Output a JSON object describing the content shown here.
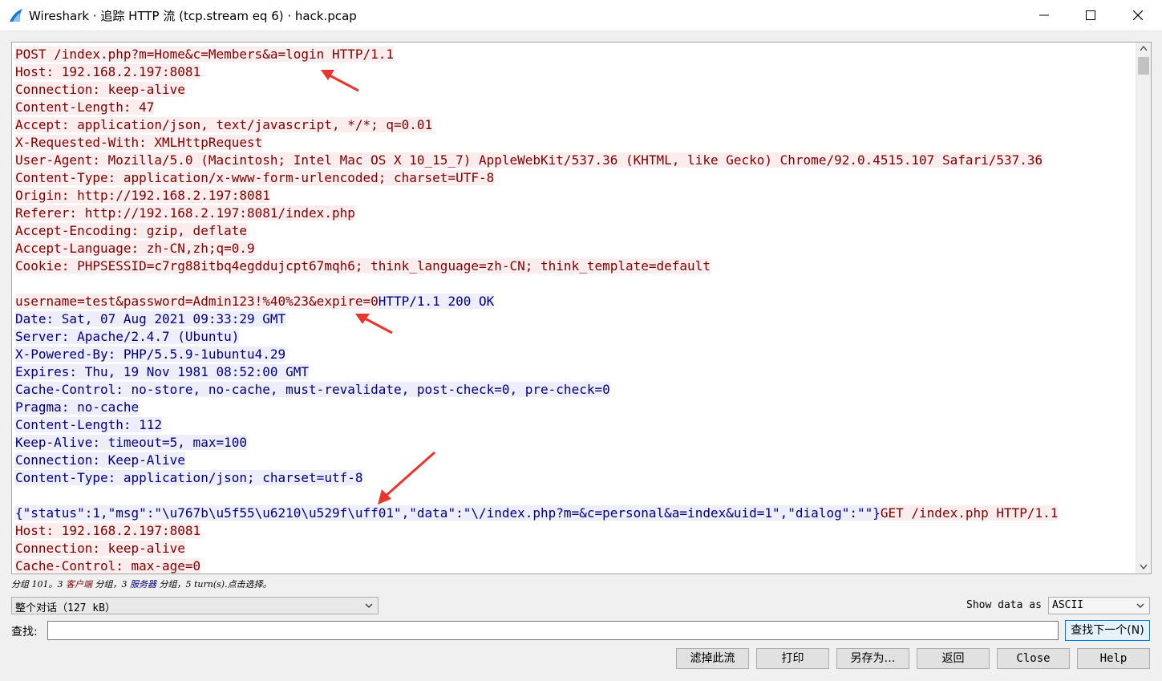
{
  "window": {
    "title": "Wireshark · 追踪 HTTP 流 (tcp.stream eq 6) · hack.pcap"
  },
  "colors": {
    "client_text": "#800000",
    "client_bg": "#fbeded",
    "server_text": "#000080",
    "server_bg": "#ededfb",
    "annotation_arrow": "#e8352e"
  },
  "icons": {
    "app": "wireshark-fin-icon",
    "minimize": "minimize-icon",
    "maximize": "maximize-icon",
    "close": "close-icon",
    "scroll_up": "chevron-up-icon",
    "scroll_down": "chevron-down-icon",
    "combo": "chevron-down-icon"
  },
  "stream": {
    "lines": [
      [
        {
          "dir": "c",
          "text": "POST /index.php?m=Home&c=Members&a=login HTTP/1.1"
        }
      ],
      [
        {
          "dir": "c",
          "text": "Host: 192.168.2.197:8081"
        }
      ],
      [
        {
          "dir": "c",
          "text": "Connection: keep-alive"
        }
      ],
      [
        {
          "dir": "c",
          "text": "Content-Length: 47"
        }
      ],
      [
        {
          "dir": "c",
          "text": "Accept: application/json, text/javascript, */*; q=0.01"
        }
      ],
      [
        {
          "dir": "c",
          "text": "X-Requested-With: XMLHttpRequest"
        }
      ],
      [
        {
          "dir": "c",
          "text": "User-Agent: Mozilla/5.0 (Macintosh; Intel Mac OS X 10_15_7) AppleWebKit/537.36 (KHTML, like Gecko) Chrome/92.0.4515.107 Safari/537.36"
        }
      ],
      [
        {
          "dir": "c",
          "text": "Content-Type: application/x-www-form-urlencoded; charset=UTF-8"
        }
      ],
      [
        {
          "dir": "c",
          "text": "Origin: http://192.168.2.197:8081"
        }
      ],
      [
        {
          "dir": "c",
          "text": "Referer: http://192.168.2.197:8081/index.php"
        }
      ],
      [
        {
          "dir": "c",
          "text": "Accept-Encoding: gzip, deflate"
        }
      ],
      [
        {
          "dir": "c",
          "text": "Accept-Language: zh-CN,zh;q=0.9"
        }
      ],
      [
        {
          "dir": "c",
          "text": "Cookie: PHPSESSID=c7rg88itbq4egddujcpt67mqh6; think_language=zh-CN; think_template=default"
        }
      ],
      [],
      [
        {
          "dir": "c",
          "text": "username=test&password=Admin123!%40%23&expire=0"
        },
        {
          "dir": "s",
          "text": "HTTP/1.1 200 OK"
        }
      ],
      [
        {
          "dir": "s",
          "text": "Date: Sat, 07 Aug 2021 09:33:29 GMT"
        }
      ],
      [
        {
          "dir": "s",
          "text": "Server: Apache/2.4.7 (Ubuntu)"
        }
      ],
      [
        {
          "dir": "s",
          "text": "X-Powered-By: PHP/5.5.9-1ubuntu4.29"
        }
      ],
      [
        {
          "dir": "s",
          "text": "Expires: Thu, 19 Nov 1981 08:52:00 GMT"
        }
      ],
      [
        {
          "dir": "s",
          "text": "Cache-Control: no-store, no-cache, must-revalidate, post-check=0, pre-check=0"
        }
      ],
      [
        {
          "dir": "s",
          "text": "Pragma: no-cache"
        }
      ],
      [
        {
          "dir": "s",
          "text": "Content-Length: 112"
        }
      ],
      [
        {
          "dir": "s",
          "text": "Keep-Alive: timeout=5, max=100"
        }
      ],
      [
        {
          "dir": "s",
          "text": "Connection: Keep-Alive"
        }
      ],
      [
        {
          "dir": "s",
          "text": "Content-Type: application/json; charset=utf-8"
        }
      ],
      [],
      [
        {
          "dir": "s",
          "text": "{\"status\":1,\"msg\":\"\\u767b\\u5f55\\u6210\\u529f\\uff01\",\"data\":\"\\/index.php?m=&c=personal&a=index&uid=1\",\"dialog\":\"\"}"
        },
        {
          "dir": "c",
          "text": "GET /index.php HTTP/1.1"
        }
      ],
      [
        {
          "dir": "c",
          "text": "Host: 192.168.2.197:8081"
        }
      ],
      [
        {
          "dir": "c",
          "text": "Connection: keep-alive"
        }
      ],
      [
        {
          "dir": "c",
          "text": "Cache-Control: max-age=0"
        }
      ]
    ]
  },
  "summary": {
    "prefix": "分组 101。3 ",
    "client_word": "客户端",
    "middle": " 分组，3 ",
    "server_word": "服务器",
    "suffix": " 分组，5 turn(s).点击选择。"
  },
  "conversation_select": {
    "value": "整个对话（127 kB）"
  },
  "show_data": {
    "label": "Show data as",
    "value": "ASCII"
  },
  "find": {
    "label": "查找:",
    "value": "",
    "next_label": "查找下一个(N)"
  },
  "buttons": {
    "filter_stream": "滤掉此流",
    "print": "打印",
    "save_as": "另存为…",
    "back": "返回",
    "close": "Close",
    "help": "Help"
  }
}
